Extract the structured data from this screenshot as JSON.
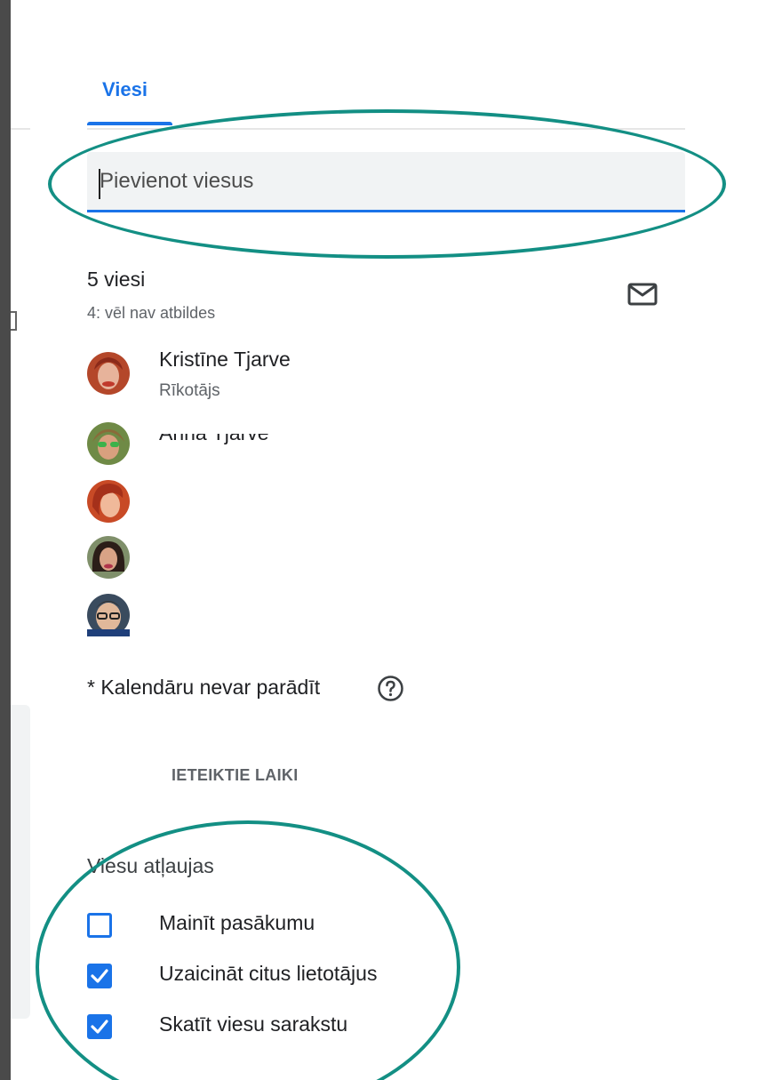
{
  "tabs": {
    "guests_label": "Viesi"
  },
  "guest_input": {
    "placeholder": "Pievienot viesus",
    "value": ""
  },
  "guests": {
    "count_text": "5 viesi",
    "pending_text": "4: vēl nav atbildes",
    "email_icon": "mail-icon",
    "list": [
      {
        "name": "Kristīne Tjarve",
        "role": "Rīkotājs",
        "avatar_color": "#b4472a"
      },
      {
        "name": "Anna Tjarve",
        "role": "",
        "avatar_color": "#6f8a46"
      },
      {
        "name": "",
        "role": "",
        "avatar_color": "#c84a26"
      },
      {
        "name": "",
        "role": "",
        "avatar_color": "#57413a"
      },
      {
        "name": "",
        "role": "",
        "avatar_color": "#3a4b5e"
      }
    ]
  },
  "calendar_note": "* Kalendāru nevar parādīt",
  "help_icon": "help-circle-icon",
  "suggested_times_label": "IETEIKTIE LAIKI",
  "permissions": {
    "title": "Viesu atļaujas",
    "items": [
      {
        "label": "Mainīt pasākumu",
        "checked": false
      },
      {
        "label": "Uzaicināt citus lietotājus",
        "checked": true
      },
      {
        "label": "Skatīt viesu sarakstu",
        "checked": true
      }
    ]
  },
  "colors": {
    "accent": "#1a73e8",
    "annotation": "#138f84",
    "input_bg": "#f1f3f4"
  }
}
